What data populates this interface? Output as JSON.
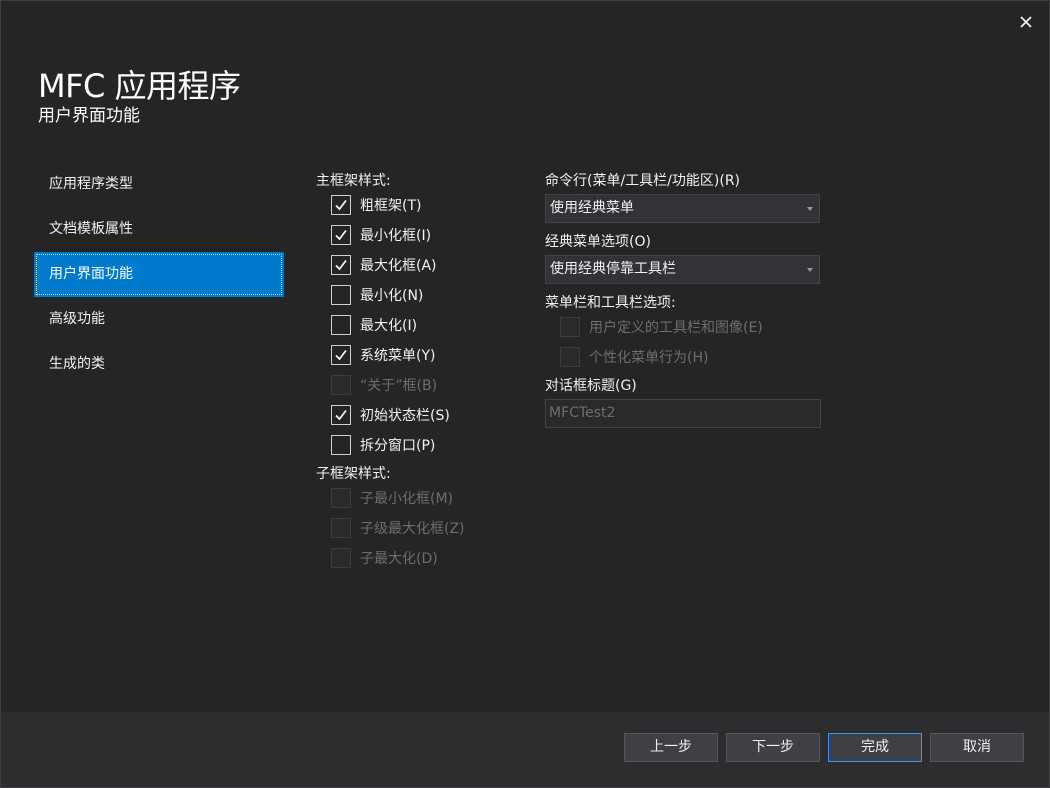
{
  "window": {
    "title": "MFC 应用程序",
    "subtitle": "用户界面功能"
  },
  "nav": {
    "items": [
      {
        "label": "应用程序类型"
      },
      {
        "label": "文档模板属性"
      },
      {
        "label": "用户界面功能",
        "selected": true
      },
      {
        "label": "高级功能"
      },
      {
        "label": "生成的类"
      }
    ]
  },
  "main_frame": {
    "label": "主框架样式:",
    "options": [
      {
        "label": "粗框架(T)",
        "checked": true,
        "enabled": true
      },
      {
        "label": "最小化框(I)",
        "checked": true,
        "enabled": true
      },
      {
        "label": "最大化框(A)",
        "checked": true,
        "enabled": true
      },
      {
        "label": "最小化(N)",
        "checked": false,
        "enabled": true
      },
      {
        "label": "最大化(I)",
        "checked": false,
        "enabled": true
      },
      {
        "label": "系统菜单(Y)",
        "checked": true,
        "enabled": true
      },
      {
        "label": "“关于”框(B)",
        "checked": false,
        "enabled": false
      },
      {
        "label": "初始状态栏(S)",
        "checked": true,
        "enabled": true
      },
      {
        "label": "拆分窗口(P)",
        "checked": false,
        "enabled": true
      }
    ]
  },
  "child_frame": {
    "label": "子框架样式:",
    "options": [
      {
        "label": "子最小化框(M)",
        "checked": false,
        "enabled": false
      },
      {
        "label": "子级最大化框(Z)",
        "checked": false,
        "enabled": false
      },
      {
        "label": "子最大化(D)",
        "checked": false,
        "enabled": false
      }
    ]
  },
  "command_bar": {
    "label": "命令行(菜单/工具栏/功能区)(R)",
    "value": "使用经典菜单"
  },
  "classic_menu": {
    "label": "经典菜单选项(O)",
    "value": "使用经典停靠工具栏"
  },
  "menubar_options": {
    "label": "菜单栏和工具栏选项:",
    "options": [
      {
        "label": "用户定义的工具栏和图像(E)",
        "checked": false,
        "enabled": false
      },
      {
        "label": "个性化菜单行为(H)",
        "checked": false,
        "enabled": false
      }
    ]
  },
  "dialog_title": {
    "label": "对话框标题(G)",
    "value": "MFCTest2"
  },
  "footer": {
    "prev_label": "上一步",
    "next_label": "下一步",
    "finish_label": "完成",
    "cancel_label": "取消"
  }
}
